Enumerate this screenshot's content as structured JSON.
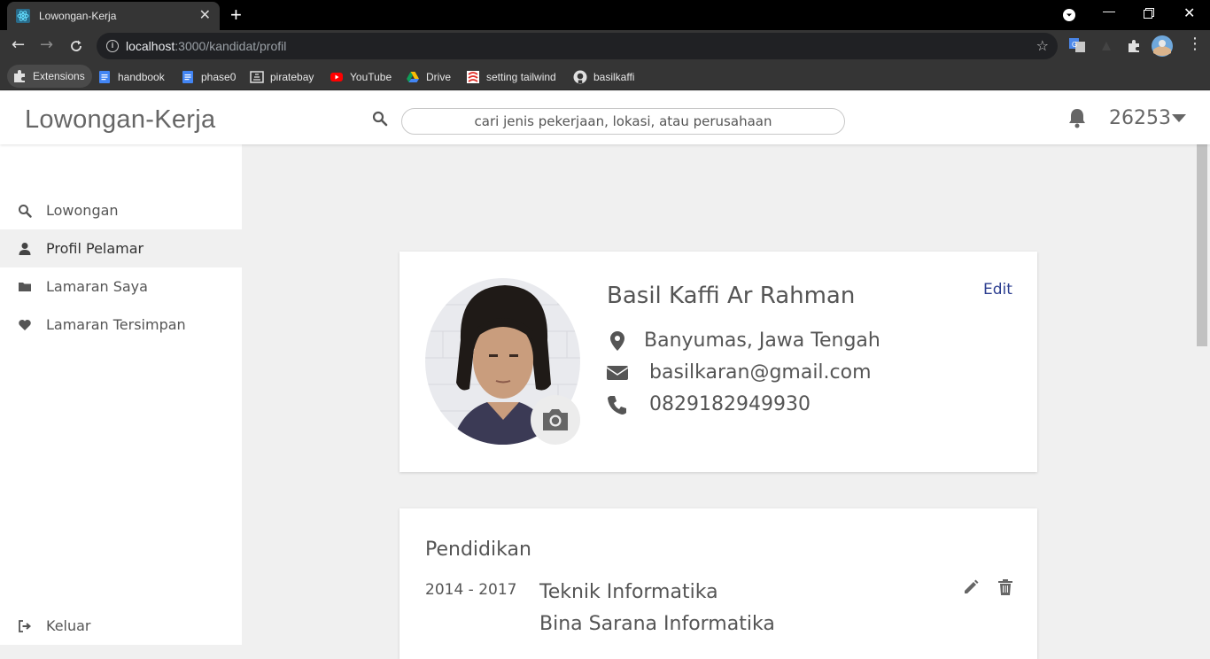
{
  "browser": {
    "tab_title": "Lowongan-Kerja",
    "url_host": "localhost",
    "url_path": ":3000/kandidat/profil",
    "bookmarks": [
      {
        "label": "Extensions",
        "icon": "puzzle-icon"
      },
      {
        "label": "handbook",
        "icon": "docs-icon"
      },
      {
        "label": "phase0",
        "icon": "docs-icon"
      },
      {
        "label": "piratebay",
        "icon": "piratebay-icon"
      },
      {
        "label": "YouTube",
        "icon": "youtube-icon"
      },
      {
        "label": "Drive",
        "icon": "drive-icon"
      },
      {
        "label": "setting tailwind",
        "icon": "bookmark-favicon-icon"
      },
      {
        "label": "basilkaffi",
        "icon": "github-icon"
      }
    ]
  },
  "header": {
    "logo": "Lowongan-Kerja",
    "search_placeholder": "cari jenis pekerjaan, lokasi, atau perusahaan",
    "user_id": "26253"
  },
  "sidebar": {
    "items": [
      {
        "label": "Lowongan",
        "icon": "search-icon"
      },
      {
        "label": "Profil Pelamar",
        "icon": "user-icon",
        "active": true
      },
      {
        "label": "Lamaran Saya",
        "icon": "folder-icon"
      },
      {
        "label": "Lamaran Tersimpan",
        "icon": "heart-icon"
      }
    ],
    "logout": {
      "label": "Keluar",
      "icon": "sign-out-icon"
    }
  },
  "profile": {
    "name": "Basil Kaffi Ar Rahman",
    "edit_label": "Edit",
    "location": "Banyumas, Jawa Tengah",
    "email": "basilkaran@gmail.com",
    "phone": "0829182949930"
  },
  "education": {
    "title": "Pendidikan",
    "entries": [
      {
        "years": "2014 - 2017",
        "major": "Teknik Informatika",
        "school": "Bina Sarana Informatika"
      }
    ]
  },
  "colors": {
    "accent_link": "#2c3e90",
    "header_bg": "#ffffff",
    "content_bg": "#f0f0f0",
    "chrome_bg": "#353535"
  }
}
